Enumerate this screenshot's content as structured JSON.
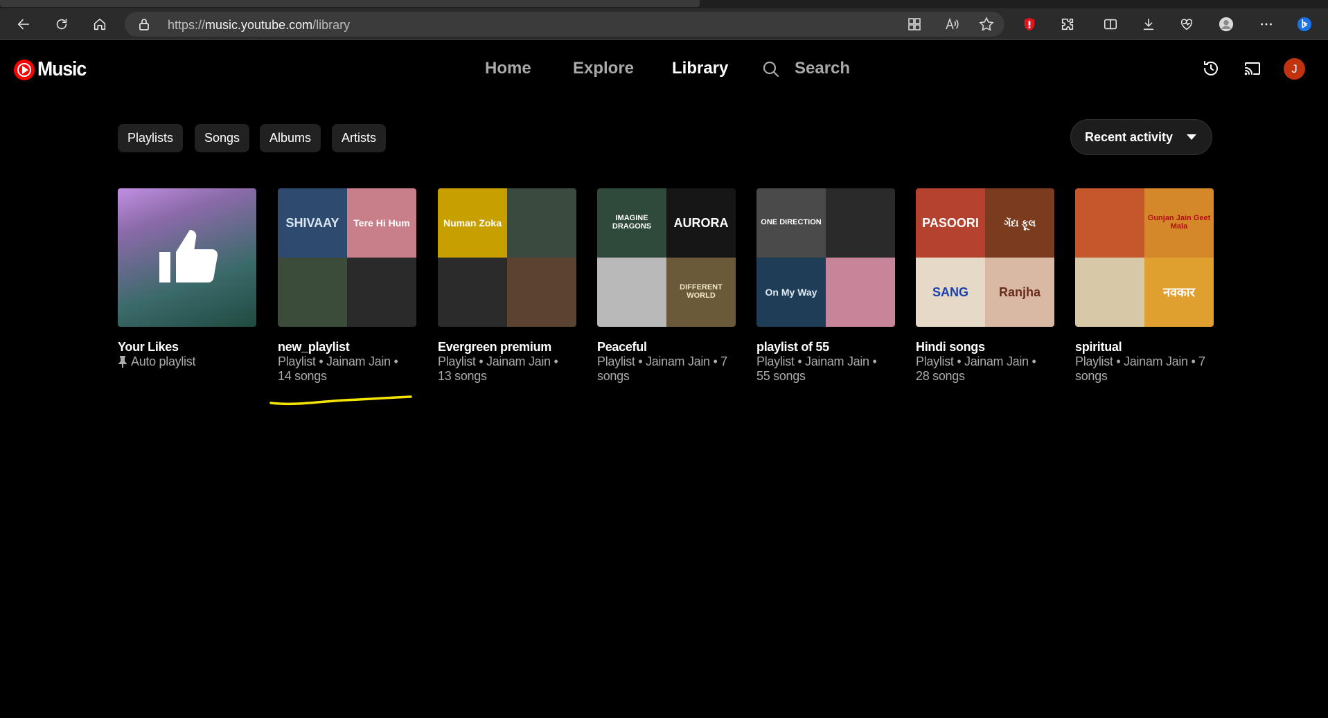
{
  "browser": {
    "url_prefix": "https://",
    "url_host": "music.youtube.com",
    "url_path": "/library"
  },
  "header": {
    "logo_text": "Music",
    "nav": [
      "Home",
      "Explore",
      "Library"
    ],
    "active_nav": "Library",
    "search_label": "Search",
    "avatar_letter": "J"
  },
  "chips": [
    "Playlists",
    "Songs",
    "Albums",
    "Artists"
  ],
  "sort": {
    "label": "Recent activity"
  },
  "cards": [
    {
      "title": "Your Likes",
      "subtitle_lines": [
        "Auto playlist"
      ],
      "pinned": true,
      "tiles": []
    },
    {
      "title": "new_playlist",
      "subtitle_lines": [
        "Playlist • Jainam Jain •",
        "14 songs"
      ],
      "tiles": [
        {
          "text": "SHIVAAY",
          "bg": "#2e4a6e",
          "fg": "#d9e6f2"
        },
        {
          "text": "Tere Hi Hum",
          "bg": "#c87f8a",
          "fg": "#ffffff"
        },
        {
          "text": "",
          "bg": "#3b4c3a",
          "fg": "#ffffff"
        },
        {
          "text": "",
          "bg": "#2a2a2a",
          "fg": "#ffffff"
        }
      ]
    },
    {
      "title": "Evergreen premium",
      "subtitle_lines": [
        "Playlist • Jainam Jain •",
        "13 songs"
      ],
      "tiles": [
        {
          "text": "Numan Zoka",
          "bg": "#c7a000",
          "fg": "#ffffff"
        },
        {
          "text": "",
          "bg": "#3a4a3e",
          "fg": "#ffffff"
        },
        {
          "text": "",
          "bg": "#2b2b2b",
          "fg": "#ffffff"
        },
        {
          "text": "",
          "bg": "#5a4330",
          "fg": "#ffffff"
        }
      ]
    },
    {
      "title": "Peaceful",
      "subtitle_lines": [
        "Playlist • Jainam Jain • 7",
        "songs"
      ],
      "tiles": [
        {
          "text": "IMAGINE DRAGONS",
          "bg": "#2f4a3a",
          "fg": "#ffffff"
        },
        {
          "text": "AURORA",
          "bg": "#161616",
          "fg": "#ffffff"
        },
        {
          "text": "",
          "bg": "#b9b9b9",
          "fg": "#222222"
        },
        {
          "text": "DIFFERENT WORLD",
          "bg": "#6a5a3a",
          "fg": "#f0e6c8"
        }
      ]
    },
    {
      "title": "playlist of 55",
      "subtitle_lines": [
        "Playlist • Jainam Jain •",
        "55 songs"
      ],
      "tiles": [
        {
          "text": "ONE DIRECTION",
          "bg": "#4a4a4a",
          "fg": "#ffffff"
        },
        {
          "text": "",
          "bg": "#2a2a2a",
          "fg": "#ffffff"
        },
        {
          "text": "On My Way",
          "bg": "#1f3d57",
          "fg": "#dfeaf5"
        },
        {
          "text": "",
          "bg": "#c7859a",
          "fg": "#ffffff"
        }
      ]
    },
    {
      "title": "Hindi songs",
      "subtitle_lines": [
        "Playlist • Jainam Jain •",
        "28 songs"
      ],
      "tiles": [
        {
          "text": "PASOORI",
          "bg": "#b5422e",
          "fg": "#ffffff"
        },
        {
          "text": "ગેંદા ફૂલ",
          "bg": "#7a3b1f",
          "fg": "#ffffff"
        },
        {
          "text": "SANG",
          "bg": "#e6d9c8",
          "fg": "#1b3fa8"
        },
        {
          "text": "Ranjha",
          "bg": "#d9b9a3",
          "fg": "#6a2a1a"
        }
      ]
    },
    {
      "title": "spiritual",
      "subtitle_lines": [
        "Playlist • Jainam Jain • 7",
        "songs"
      ],
      "tiles": [
        {
          "text": "",
          "bg": "#c4582a",
          "fg": "#ffffff"
        },
        {
          "text": "Gunjan Jain Geet Mala",
          "bg": "#d4882a",
          "fg": "#b01010"
        },
        {
          "text": "",
          "bg": "#d7c8a8",
          "fg": "#8a2a1a"
        },
        {
          "text": "नवकार",
          "bg": "#e0a030",
          "fg": "#ffffff"
        }
      ]
    }
  ],
  "colors": {
    "background": "#000000",
    "chip_bg": "#212121",
    "muted_text": "#aaaaaa",
    "brand_red": "#ff0000",
    "annotation_underline": "#f5e400"
  }
}
